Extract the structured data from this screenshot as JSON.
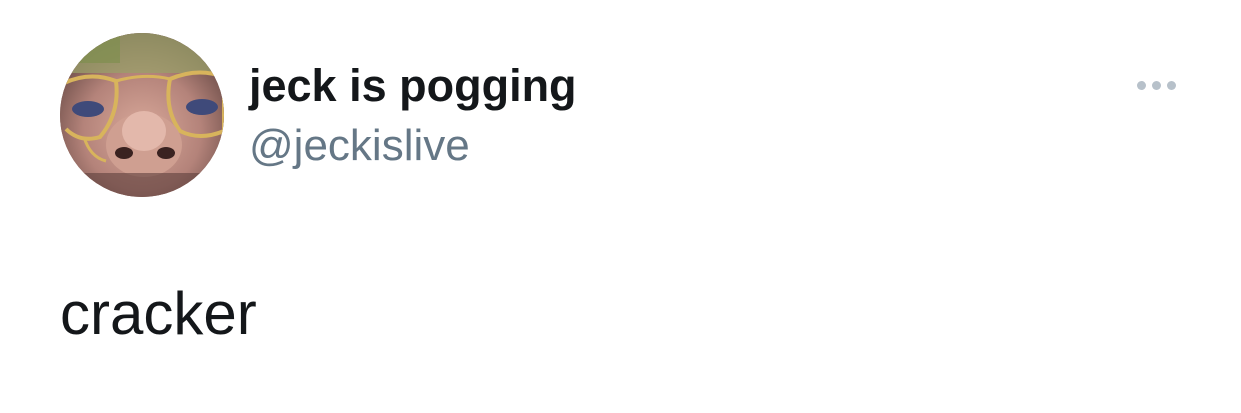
{
  "tweet": {
    "author": {
      "display_name": "jeck is pogging",
      "handle": "@jeckislive",
      "avatar_icon": "avatar-photo"
    },
    "text": "cracker",
    "more_icon": "more-horizontal-icon"
  },
  "colors": {
    "background": "#ffffff",
    "name": "#14171a",
    "handle": "#657786",
    "more_dots": "#b7c1ca"
  }
}
